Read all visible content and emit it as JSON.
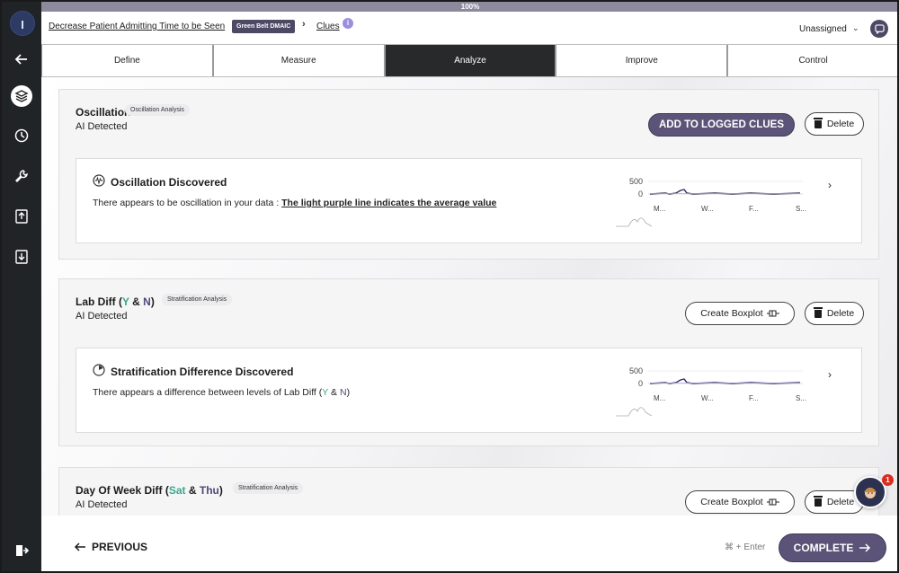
{
  "progress": {
    "label": "100%",
    "value": 1.0
  },
  "header": {
    "project_title": "Decrease Patient Admitting Time to be Seen",
    "badge": "Green Belt DMAIC",
    "separator": "›",
    "current_page": "Clues",
    "info": "i",
    "assignee": "Unassigned",
    "assignee_chevron": "⌄"
  },
  "tabs": [
    {
      "label": "Define",
      "active": false
    },
    {
      "label": "Measure",
      "active": false
    },
    {
      "label": "Analyze",
      "active": true
    },
    {
      "label": "Improve",
      "active": false
    },
    {
      "label": "Control",
      "active": false
    }
  ],
  "sidebar": {
    "icons": [
      "back-arrow-icon",
      "layers-icon",
      "clock-icon",
      "wrench-icon",
      "upload-icon",
      "download-icon",
      "logout-icon"
    ]
  },
  "clues": [
    {
      "title": "Oscillation",
      "tag": "Oscillation Analysis",
      "subtitle": "AI Detected",
      "primary_action": "ADD TO LOGGED CLUES",
      "delete_label": "Delete",
      "finding_title": "Oscillation Discovered",
      "finding_desc_prefix": "There appears to be oscillation in your data : ",
      "finding_desc_emphasis": "The light purple line indicates the average value",
      "chart": {
        "y_max_label": "500",
        "y_min_label": "0",
        "x_labels": [
          "M...",
          "W...",
          "F...",
          "S..."
        ]
      }
    },
    {
      "title": "Lab Diff",
      "title_open": "(",
      "level_a": "Y",
      "amp": "&",
      "level_b": "N",
      "title_close": ")",
      "tag": "Stratification Analysis",
      "subtitle": "AI Detected",
      "secondary_action": "Create Boxplot",
      "delete_label": "Delete",
      "finding_title": "Stratification Difference Discovered",
      "finding_desc_prefix": "There appears a difference between levels of Lab Diff",
      "desc_open": "(",
      "desc_level_a": "Y",
      "desc_amp": "&",
      "desc_level_b": "N",
      "desc_close": ")",
      "chart": {
        "y_max_label": "500",
        "y_min_label": "0",
        "x_labels": [
          "M...",
          "W...",
          "F...",
          "S..."
        ]
      }
    },
    {
      "title": "Day Of Week Diff",
      "title_open": "(",
      "level_a": "Sat",
      "amp": "&",
      "level_b": "Thu",
      "title_close": ")",
      "tag": "Stratification Analysis",
      "subtitle": "AI Detected",
      "secondary_action": "Create Boxplot",
      "delete_label": "Delete"
    }
  ],
  "footer": {
    "previous_label": "PREVIOUS",
    "shortcut": "⌘ + Enter",
    "complete_label": "COMPLETE"
  },
  "help": {
    "badge_count": "1"
  },
  "colors": {
    "primary": "#5b5478",
    "accent_green": "#3aa88f",
    "sidebar": "#212426"
  }
}
